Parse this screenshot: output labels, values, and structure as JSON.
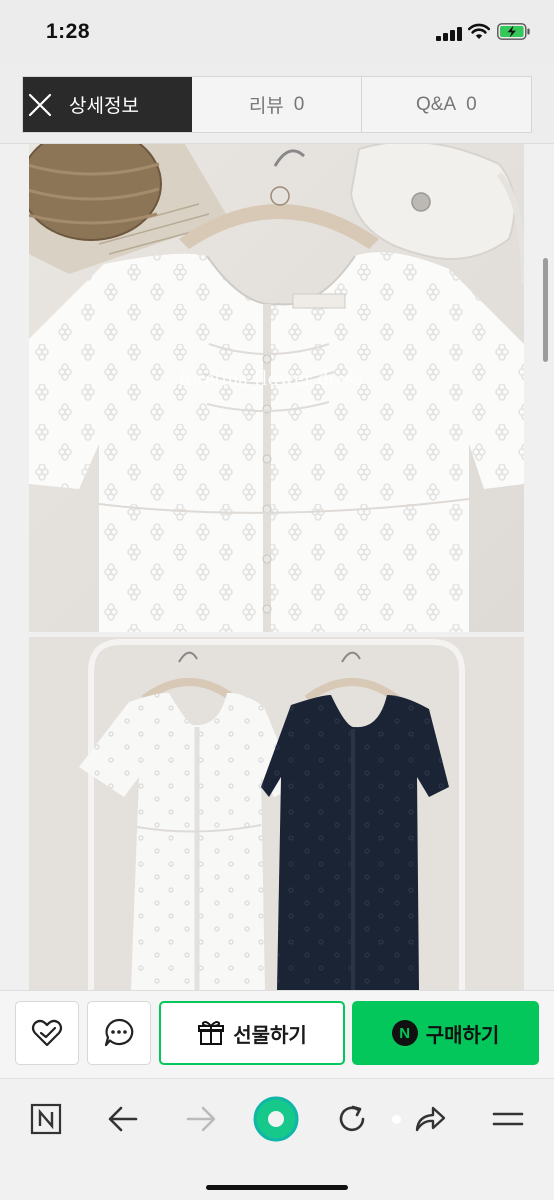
{
  "status_bar": {
    "time": "1:28"
  },
  "tabs": {
    "detail_label": "상세정보",
    "review_label": "리뷰",
    "review_count": "0",
    "qna_label": "Q&A",
    "qna_count": "0"
  },
  "content": {
    "photo_caption": "foretina flower dress"
  },
  "actions": {
    "gift_label": "선물하기",
    "buy_label": "구매하기",
    "buy_badge": "N"
  },
  "colors": {
    "accent": "#03c75a",
    "tab_active_bg": "#2a2a2a",
    "navy_dress": "#1b2435"
  },
  "browser_toolbar": {
    "icons": [
      "n-logo-icon",
      "back-arrow-icon",
      "forward-arrow-icon",
      "green-ball-icon",
      "refresh-icon",
      "share-icon",
      "menu-icon"
    ]
  }
}
